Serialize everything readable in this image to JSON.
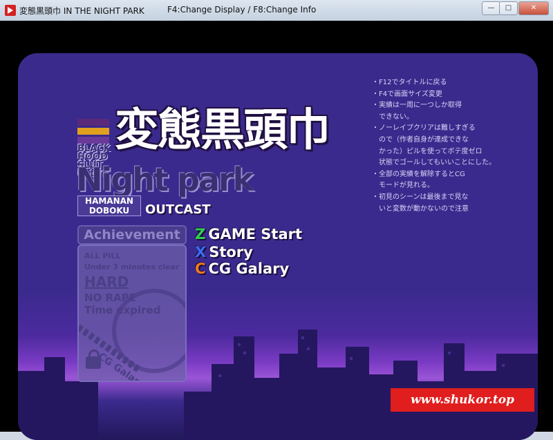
{
  "window": {
    "title": "変態黒頭巾 IN THE NIGHT PARK",
    "info": "F4:Change Display / F8:Change Info",
    "minimize_label": "—",
    "maximize_label": "□",
    "close_label": "✕"
  },
  "logo": {
    "title_jp": "変態黒頭巾",
    "subtitle_lines": [
      "BLACK",
      "HOOD",
      "SLUT",
      "in the"
    ],
    "subtitle_big": "Night park",
    "maker_lines": [
      "HAMANAN",
      "DOBOKU"
    ],
    "outcast": "OUTCAST",
    "stripe_colors": [
      "#5a2a7a",
      "#e0a020",
      "#6a3a9a"
    ]
  },
  "achievement": {
    "title": "Achievement",
    "items": [
      "ALL PILL",
      "Under 3 minutes clear",
      "HARD",
      "NO RAPE",
      "Time expired"
    ],
    "cg_label": "CG Galary"
  },
  "menu": [
    {
      "key": "Z",
      "label": "GAME Start",
      "key_color": "#2fd04a"
    },
    {
      "key": "X",
      "label": "Story",
      "key_color": "#3a6cf0"
    },
    {
      "key": "C",
      "label": "CG Galary",
      "key_color": "#f07a20"
    }
  ],
  "notes": [
    "・F12でタイトルに戻る",
    "・F4で画面サイズ変更",
    "・実績は一周に一つしか取得",
    "　できない。",
    "・ノーレイプクリアは難しすぎる",
    "　ので（作者自身が達成できな",
    "　かった）ピルを使ってボテ度ゼロ",
    "　状態でゴールしてもいいことにした。",
    "・全部の実績を解除するとCG",
    "　モードが見れる。",
    "・初見のシーンは最後まで見な",
    "　いと変数が動かないので注意"
  ],
  "watermark": "www.shukor.top"
}
